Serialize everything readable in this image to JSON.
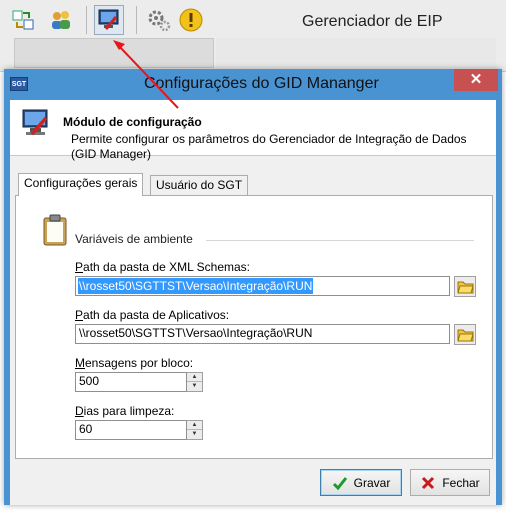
{
  "app": {
    "title": "Gerenciador de EIP",
    "toolbar": [
      "refresh-icon",
      "users-icon",
      "config-icon",
      "settings-gears-icon",
      "warning-icon"
    ]
  },
  "dialog": {
    "title": "Configurações do GID Mananger",
    "app_icon_text": "SGT",
    "close_label": "✕",
    "header": {
      "title": "Módulo de configuração",
      "description": "Permite configurar os parâmetros do Gerenciador de Integração de Dados (GID Manager)"
    },
    "tabs": [
      {
        "label": "Configurações gerais",
        "active": true
      },
      {
        "label": "Usuário do SGT",
        "active": false
      }
    ],
    "group": {
      "label": "Variáveis de ambiente"
    },
    "fields": {
      "xml_path": {
        "label_hotkey": "P",
        "label_rest": "ath da pasta de XML Schemas:",
        "value": "\\\\rosset50\\SGTTST\\Versao\\Integração\\RUN"
      },
      "app_path": {
        "label_hotkey": "P",
        "label_rest": "ath da pasta de Aplicativos:",
        "value": "\\\\rosset50\\SGTTST\\Versao\\Integração\\RUN"
      },
      "messages": {
        "label_hotkey": "M",
        "label_rest": "ensagens por bloco:",
        "value": "500"
      },
      "cleanup_days": {
        "label_hotkey": "D",
        "label_rest": "ias para limpeza:",
        "value": "60"
      }
    },
    "buttons": {
      "save": "Gravar",
      "close": "Fechar"
    }
  },
  "colors": {
    "titlebar": "#4a93d3",
    "close": "#c75050",
    "selection": "#3399ff",
    "arrow": "#e8161b"
  }
}
